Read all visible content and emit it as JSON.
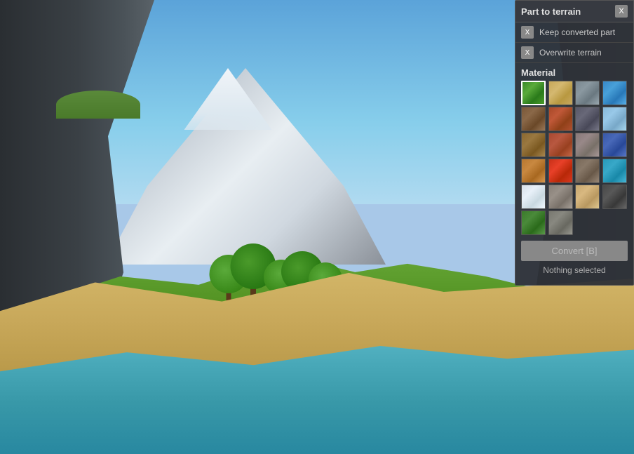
{
  "panel": {
    "title": "Part to terrain",
    "close_label": "X",
    "keep_converted_label": "Keep converted part",
    "overwrite_terrain_label": "Overwrite terrain",
    "material_section_label": "Material",
    "convert_button_label": "Convert [B]",
    "status_text": "Nothing selected",
    "materials": [
      {
        "id": "grass",
        "class": "mat-grass",
        "selected": true
      },
      {
        "id": "sand",
        "class": "mat-sand",
        "selected": false
      },
      {
        "id": "rock",
        "class": "mat-rock",
        "selected": false
      },
      {
        "id": "water",
        "class": "mat-water",
        "selected": false
      },
      {
        "id": "dirt",
        "class": "mat-dirt",
        "selected": false
      },
      {
        "id": "rust",
        "class": "mat-rust",
        "selected": false
      },
      {
        "id": "slate",
        "class": "mat-slate",
        "selected": false
      },
      {
        "id": "ice",
        "class": "mat-ice",
        "selected": false
      },
      {
        "id": "woodplank",
        "class": "mat-woodplank",
        "selected": false
      },
      {
        "id": "brick",
        "class": "mat-brick",
        "selected": false
      },
      {
        "id": "granite",
        "class": "mat-granite",
        "selected": false
      },
      {
        "id": "cobalt",
        "class": "mat-cobalt",
        "selected": false
      },
      {
        "id": "wood",
        "class": "mat-wood",
        "selected": false
      },
      {
        "id": "lava",
        "class": "mat-lava",
        "selected": false
      },
      {
        "id": "mud",
        "class": "mat-mud",
        "selected": false
      },
      {
        "id": "seawater",
        "class": "mat-seawater",
        "selected": false
      },
      {
        "id": "snow",
        "class": "mat-snow",
        "selected": false
      },
      {
        "id": "cobblestone",
        "class": "mat-cobblestone",
        "selected": false
      },
      {
        "id": "sandstone",
        "class": "mat-sandstone",
        "selected": false
      },
      {
        "id": "darkrock",
        "class": "mat-darkrock",
        "selected": false
      },
      {
        "id": "leafy",
        "class": "mat-leafy",
        "selected": false
      },
      {
        "id": "cobblestone2",
        "class": "mat-cobblestone2",
        "selected": false
      }
    ]
  }
}
